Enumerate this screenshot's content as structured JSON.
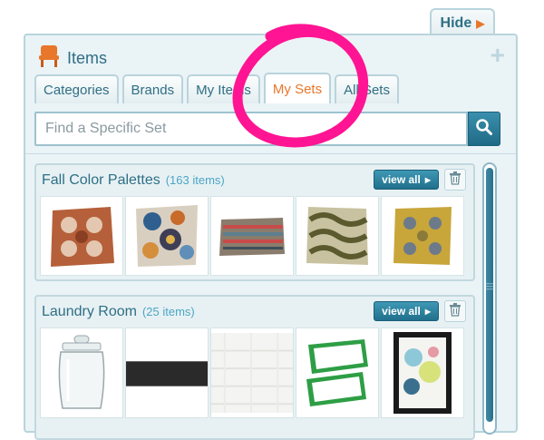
{
  "hide_tab": {
    "label": "Hide"
  },
  "panel": {
    "title": "Items",
    "tabs": [
      {
        "label": "Categories"
      },
      {
        "label": "Brands"
      },
      {
        "label": "My Items"
      },
      {
        "label": "My Sets",
        "active": true
      },
      {
        "label": "All Sets"
      }
    ],
    "search": {
      "placeholder": "Find a Specific Set"
    }
  },
  "sets": [
    {
      "name": "Fall Color Palettes",
      "count": "(163 items)",
      "view_all": "view all",
      "thumbnails": [
        "rust-medallion-pillow",
        "blue-floral-pillow",
        "striped-lumbar-pillow",
        "olive-wave-pillow",
        "gold-ikat-pillow"
      ]
    },
    {
      "name": "Laundry Room",
      "count": "(25 items)",
      "view_all": "view all",
      "thumbnails": [
        "glass-canister",
        "black-shelf",
        "white-textured-rug",
        "green-frames",
        "abstract-framed-art"
      ]
    }
  ],
  "colors": {
    "accent": "#e8772b",
    "brand": "#2e6f85",
    "annotation": "#ff1493"
  }
}
